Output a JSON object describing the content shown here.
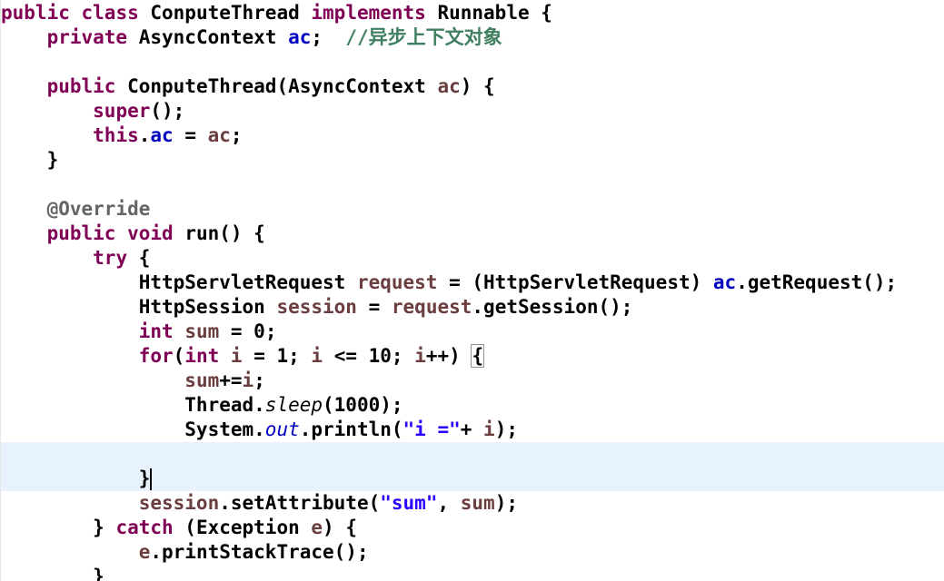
{
  "editor": {
    "comment_text": "//异步上下文对象",
    "string_sum": "\"sum\"",
    "string_i": "\"i =\""
  }
}
